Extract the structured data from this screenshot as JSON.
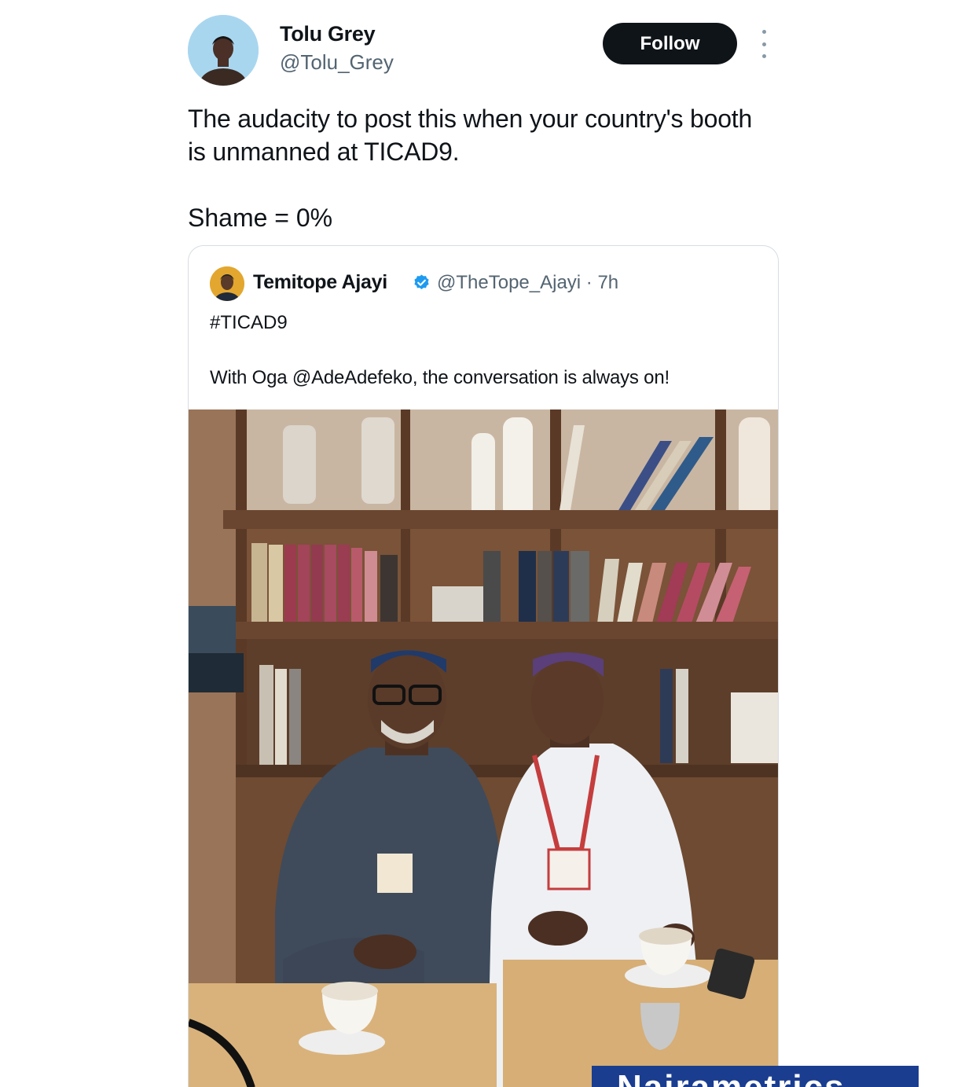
{
  "tweet": {
    "author": {
      "name": "Tolu Grey",
      "handle": "@Tolu_Grey",
      "avatar_icon": "person-avatar-icon"
    },
    "follow_label": "Follow",
    "more_icon": "more-options-icon",
    "text_line1": "The audacity to post this when your country's booth is unmanned at TICAD9.",
    "text_line2": "Shame = 0%"
  },
  "quoted_tweet": {
    "author": {
      "name": "Temitope Ajayi",
      "verified": true,
      "handle_time": "@TheTope_Ajayi · 7h"
    },
    "hashtag": "#TICAD9",
    "body": "With Oga @AdeAdefeko, the conversation is always on!",
    "photo_icon": "photo-two-men-bookshelf"
  },
  "watermark": {
    "text": "Nairametrics"
  },
  "colors": {
    "follow_bg": "#0f1419",
    "verified_blue": "#1d9bf0",
    "watermark_bg": "#1a3d8f",
    "avatar_bg": "#a9d6ef"
  }
}
